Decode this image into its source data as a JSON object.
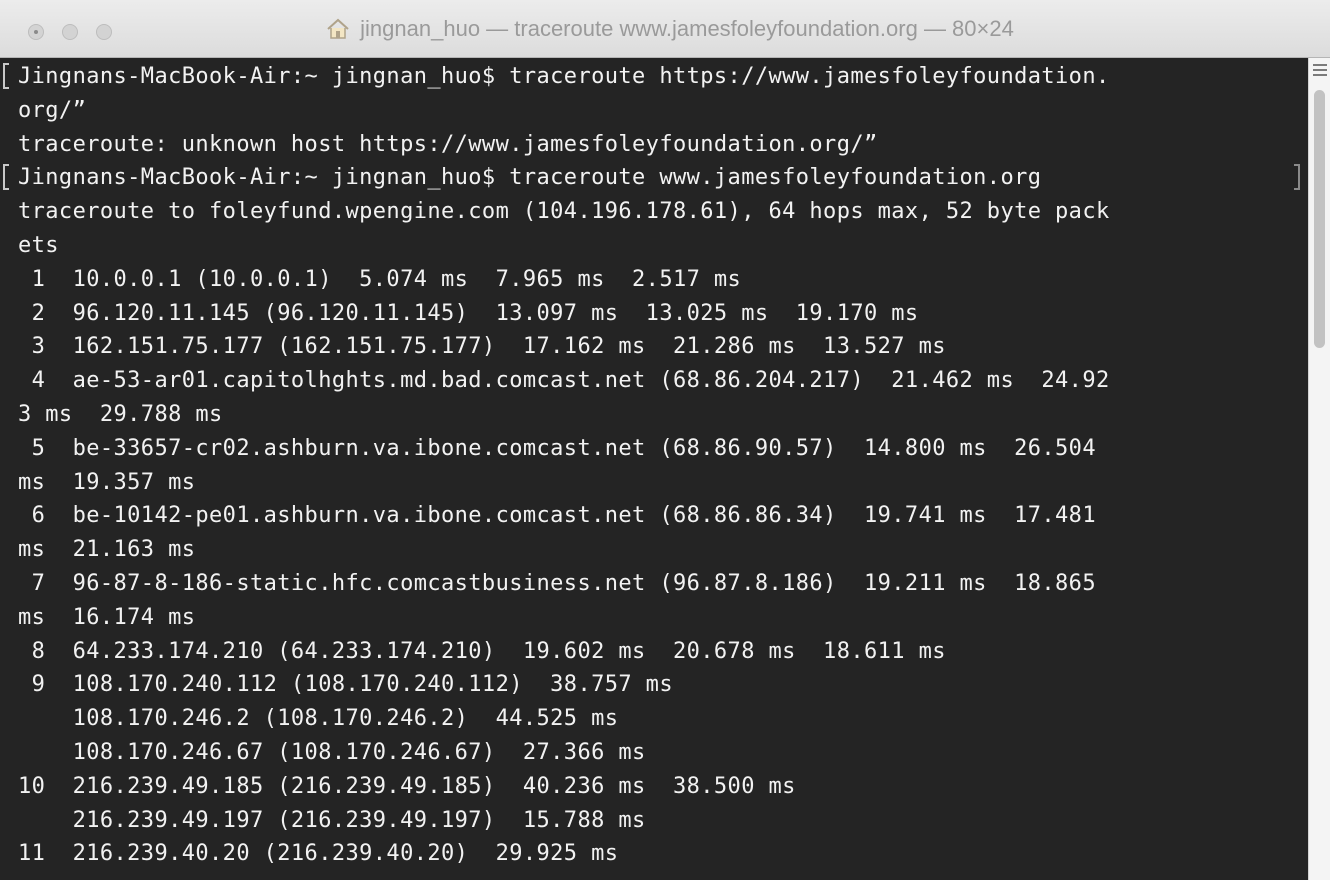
{
  "window": {
    "title": "jingnan_huo — traceroute www.jamesfoleyfoundation.org — 80×24",
    "title_icon": "home-icon",
    "accent_colors": {
      "terminal_bg": "#242424",
      "terminal_text": "#f2f2f2",
      "titlebar_text": "#9a9a9a"
    }
  },
  "terminal": {
    "lines": [
      "Jingnans-MacBook-Air:~ jingnan_huo$ traceroute https://www.jamesfoleyfoundation.",
      "org/”",
      "traceroute: unknown host https://www.jamesfoleyfoundation.org/”",
      "Jingnans-MacBook-Air:~ jingnan_huo$ traceroute www.jamesfoleyfoundation.org",
      "traceroute to foleyfund.wpengine.com (104.196.178.61), 64 hops max, 52 byte pack",
      "ets",
      " 1  10.0.0.1 (10.0.0.1)  5.074 ms  7.965 ms  2.517 ms",
      " 2  96.120.11.145 (96.120.11.145)  13.097 ms  13.025 ms  19.170 ms",
      " 3  162.151.75.177 (162.151.75.177)  17.162 ms  21.286 ms  13.527 ms",
      " 4  ae-53-ar01.capitolhghts.md.bad.comcast.net (68.86.204.217)  21.462 ms  24.92",
      "3 ms  29.788 ms",
      " 5  be-33657-cr02.ashburn.va.ibone.comcast.net (68.86.90.57)  14.800 ms  26.504 ",
      "ms  19.357 ms",
      " 6  be-10142-pe01.ashburn.va.ibone.comcast.net (68.86.86.34)  19.741 ms  17.481 ",
      "ms  21.163 ms",
      " 7  96-87-8-186-static.hfc.comcastbusiness.net (96.87.8.186)  19.211 ms  18.865 ",
      "ms  16.174 ms",
      " 8  64.233.174.210 (64.233.174.210)  19.602 ms  20.678 ms  18.611 ms",
      " 9  108.170.240.112 (108.170.240.112)  38.757 ms",
      "    108.170.246.2 (108.170.246.2)  44.525 ms",
      "    108.170.246.67 (108.170.246.67)  27.366 ms",
      "10  216.239.49.185 (216.239.49.185)  40.236 ms  38.500 ms",
      "    216.239.49.197 (216.239.49.197)  15.788 ms",
      "11  216.239.40.20 (216.239.40.20)  29.925 ms"
    ]
  },
  "scrollbar": {
    "menu_icon": "hamburger-icon"
  }
}
